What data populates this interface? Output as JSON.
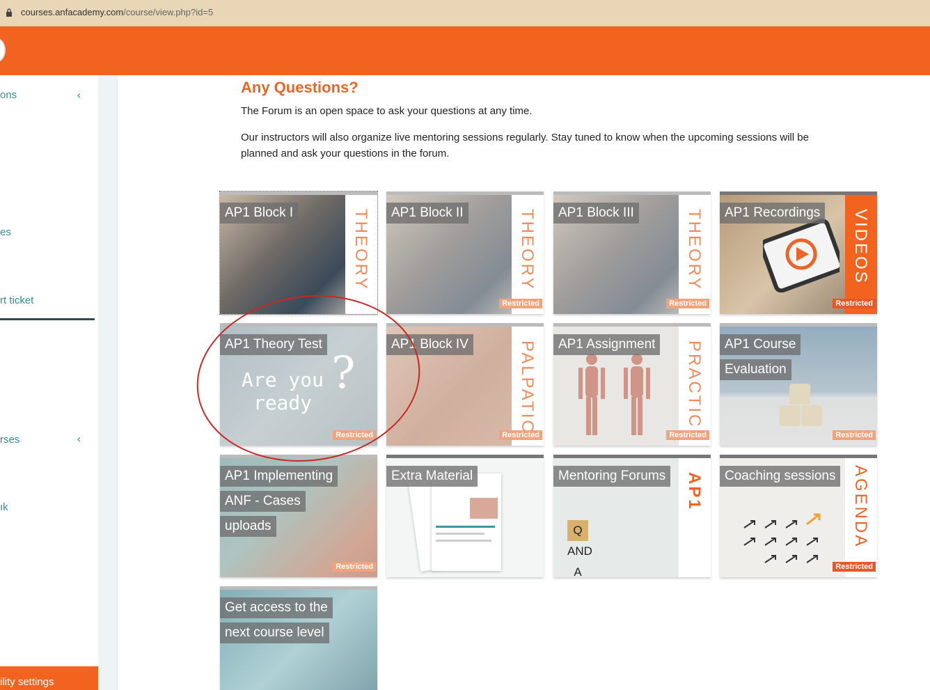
{
  "browser": {
    "url_host": "courses.anfacademy.com",
    "url_path": "/course/view.php?id=5"
  },
  "sidebar": {
    "items": [
      {
        "label": "ons",
        "chevron": "‹"
      },
      {
        "label": "es"
      },
      {
        "label": "rt ticket"
      },
      {
        "label": "rses",
        "chevron": "‹"
      },
      {
        "label": "ık"
      }
    ],
    "settings_label": "ility settings"
  },
  "content": {
    "heading": "Any Questions?",
    "p1": "The Forum is an open space to ask your questions at any time.",
    "p2": "Our instructors will also organize live mentoring sessions regularly. Stay tuned to know when the upcoming sessions will be planned and ask your questions in the forum."
  },
  "tiles": [
    {
      "title": [
        "AP1 Block I"
      ],
      "side": "THEORY",
      "restricted": ""
    },
    {
      "title": [
        "AP1 Block II"
      ],
      "side": "THEORY",
      "restricted": "Restricted"
    },
    {
      "title": [
        "AP1 Block III"
      ],
      "side": "THEORY",
      "restricted": "Restricted"
    },
    {
      "title": [
        "AP1 Recordings"
      ],
      "side": "VIDEOS",
      "restricted": "Restricted"
    },
    {
      "title": [
        "AP1 Theory Test"
      ],
      "side": "",
      "restricted": "Restricted",
      "overlay": "Are you ready"
    },
    {
      "title": [
        "AP1 Block IV"
      ],
      "side": "PALPATIO",
      "restricted": "Restricted"
    },
    {
      "title": [
        "AP1 Assignment"
      ],
      "side": "PRACTIC",
      "restricted": "Restricted"
    },
    {
      "title": [
        "AP1 Course",
        "Evaluation"
      ],
      "side": "",
      "restricted": "Restricted"
    },
    {
      "title": [
        "AP1 Implementing",
        "ANF - Cases",
        "uploads"
      ],
      "side": "",
      "restricted": "Restricted"
    },
    {
      "title": [
        "Extra Material"
      ],
      "side": "",
      "restricted": ""
    },
    {
      "title": [
        "Mentoring Forums"
      ],
      "side": "AP1",
      "restricted": "",
      "overlay": "Q AND A"
    },
    {
      "title": [
        "Coaching sessions"
      ],
      "side": "AGENDA",
      "restricted": "Restricted"
    },
    {
      "title": [
        "Get access to the",
        "next course level"
      ],
      "side": "",
      "restricted": ""
    }
  ],
  "colors": {
    "brand": "#f36320",
    "accent_text": "#e8662a",
    "sidebar_link": "#3a8a96"
  }
}
